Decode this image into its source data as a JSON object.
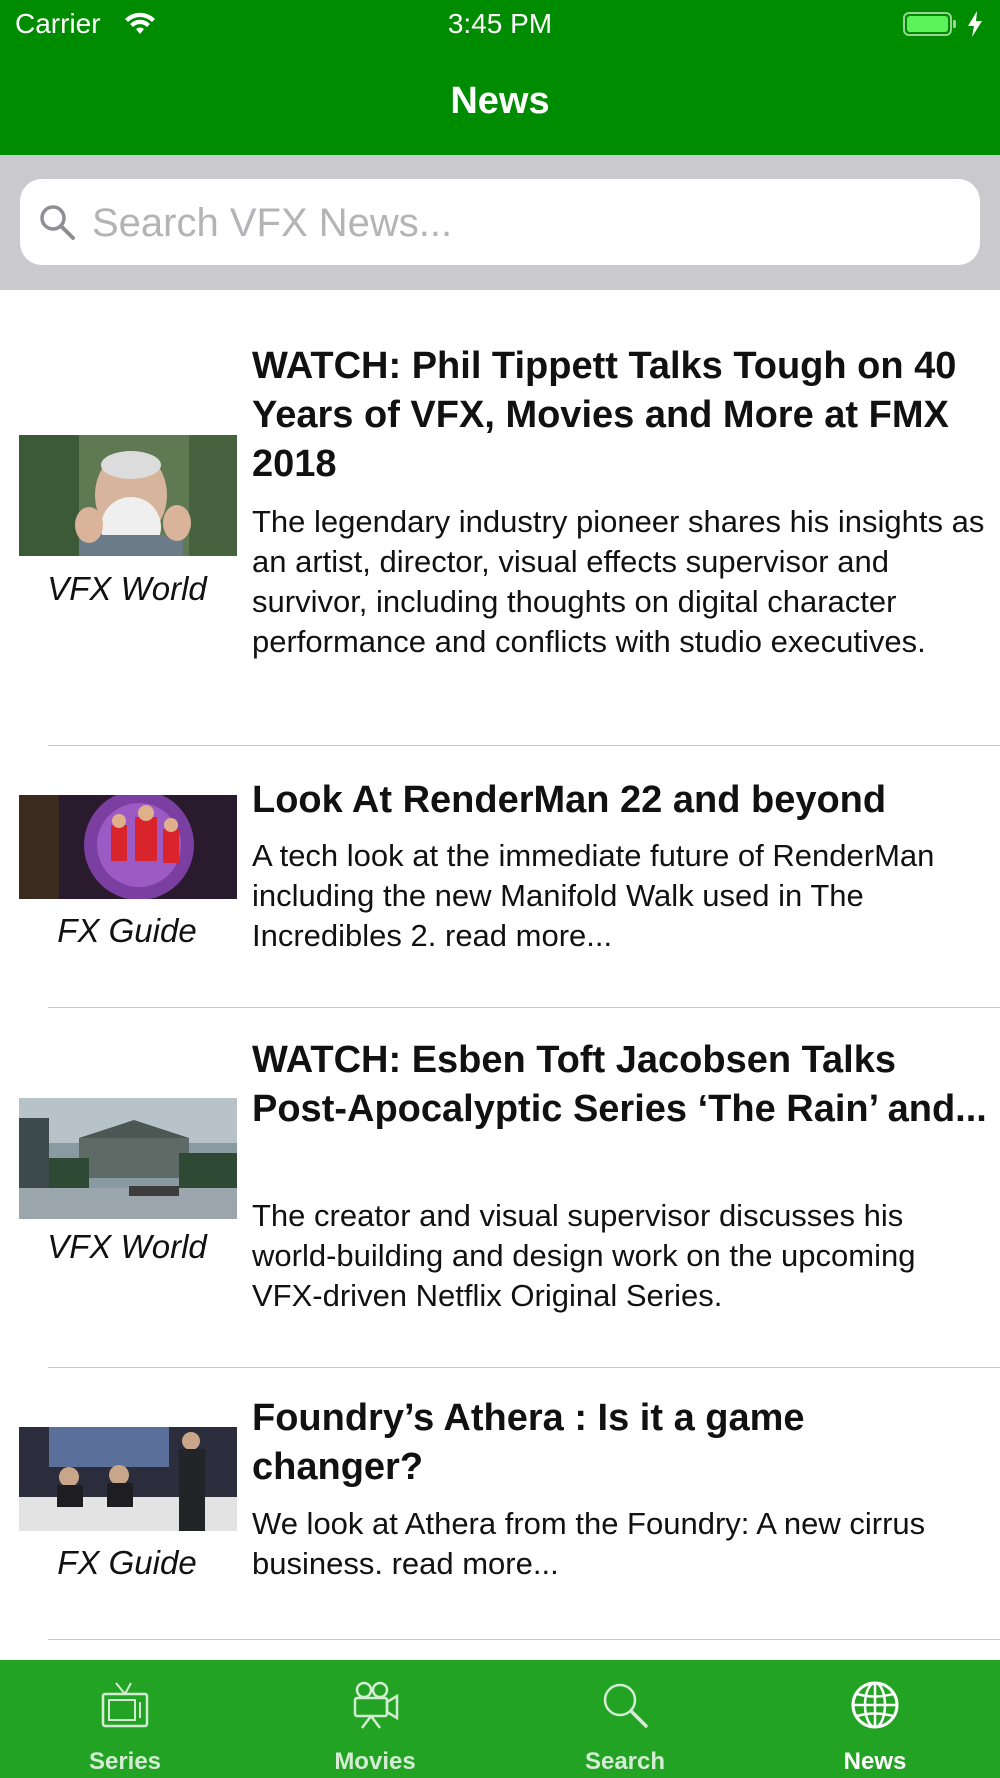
{
  "status_bar": {
    "carrier": "Carrier",
    "time": "3:45 PM",
    "icons": [
      "wifi-icon",
      "battery-icon",
      "charging-bolt-icon"
    ]
  },
  "nav": {
    "title": "News"
  },
  "search": {
    "placeholder": "Search VFX News...",
    "value": "",
    "icon": "search-icon"
  },
  "articles": [
    {
      "source": "VFX World",
      "headline": "WATCH: Phil Tippett Talks Tough on 40 Years of VFX, Movies and More at FMX 2018",
      "summary": "The legendary industry pioneer shares his insights as an artist, director, visual effects supervisor and survivor, including thoughts on digital character performance and conflicts with studio executives."
    },
    {
      "source": "FX Guide",
      "headline": "Look At RenderMan 22 and beyond",
      "summary": "A tech look at the immediate future of RenderMan including the new Manifold Walk used in The Incredibles 2. read more..."
    },
    {
      "source": "VFX World",
      "headline": "WATCH: Esben Toft Jacobsen Talks Post-Apocalyptic Series ‘The Rain’ and...",
      "summary": "The creator and visual supervisor discusses his world-building and design work on the upcoming VFX-driven Netflix Original Series."
    },
    {
      "source": "FX Guide",
      "headline": "Foundry’s Athera : Is it a game changer?",
      "summary": "We look at Athera from the Foundry: A new cirrus business. read more..."
    }
  ],
  "tabs": [
    {
      "label": "Series",
      "icon": "tv-icon",
      "active": false
    },
    {
      "label": "Movies",
      "icon": "movie-camera-icon",
      "active": false
    },
    {
      "label": "Search",
      "icon": "search-icon",
      "active": false
    },
    {
      "label": "News",
      "icon": "globe-icon",
      "active": true
    }
  ],
  "colors": {
    "header_green": "#008c00",
    "tab_bar_green": "#23a323",
    "search_section_gray": "#c9c9ce",
    "divider": "#c8c8cc"
  }
}
